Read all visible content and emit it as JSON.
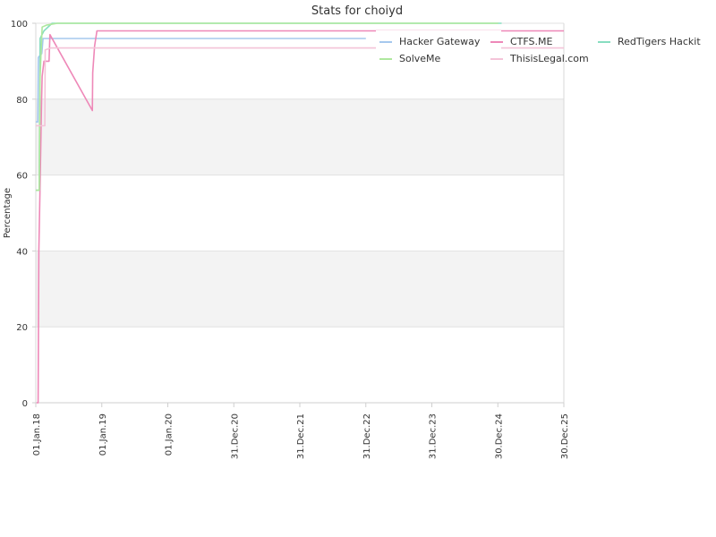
{
  "chart_data": {
    "type": "line",
    "title": "Stats for choiyd",
    "ylabel": "Percentage",
    "xlabel": "",
    "ylim": [
      0,
      100
    ],
    "yticks": [
      0,
      20,
      40,
      60,
      80,
      100
    ],
    "xlim": [
      "2018-01-01",
      "2025-12-30"
    ],
    "xticks": [
      {
        "date": "2018-01-01",
        "label": "01.Jan.18"
      },
      {
        "date": "2019-01-01",
        "label": "01.Jan.19"
      },
      {
        "date": "2020-01-01",
        "label": "01.Jan.20"
      },
      {
        "date": "2020-12-31",
        "label": "31.Dec.20"
      },
      {
        "date": "2021-12-31",
        "label": "31.Dec.21"
      },
      {
        "date": "2022-12-31",
        "label": "31.Dec.22"
      },
      {
        "date": "2023-12-31",
        "label": "31.Dec.23"
      },
      {
        "date": "2024-12-30",
        "label": "30.Dec.24"
      },
      {
        "date": "2025-12-30",
        "label": "30.Dec.25"
      }
    ],
    "grid": true,
    "legend_position": "top-right",
    "series": [
      {
        "name": "Hacker Gateway",
        "color": "#a6c8ee",
        "points": [
          [
            "2018-01-01",
            74
          ],
          [
            "2018-01-12",
            74
          ],
          [
            "2018-01-15",
            91
          ],
          [
            "2018-02-03",
            92
          ],
          [
            "2018-02-10",
            96
          ],
          [
            "2022-12-31",
            96
          ]
        ]
      },
      {
        "name": "CTFS.ME",
        "color": "#ee88b8",
        "points": [
          [
            "2018-01-05",
            0
          ],
          [
            "2018-01-14",
            0
          ],
          [
            "2018-01-18",
            40
          ],
          [
            "2018-01-24",
            55
          ],
          [
            "2018-02-02",
            80
          ],
          [
            "2018-02-05",
            86
          ],
          [
            "2018-02-15",
            90
          ],
          [
            "2018-03-15",
            90
          ],
          [
            "2018-03-20",
            97
          ],
          [
            "2018-11-10",
            77
          ],
          [
            "2018-11-12",
            87
          ],
          [
            "2018-11-22",
            94
          ],
          [
            "2018-12-05",
            98
          ],
          [
            "2025-12-30",
            98
          ]
        ]
      },
      {
        "name": "RedTigers Hackit",
        "color": "#88ddc0",
        "points": [
          [
            "2018-01-01",
            56
          ],
          [
            "2018-01-20",
            56
          ],
          [
            "2018-01-25",
            96
          ],
          [
            "2018-02-15",
            98
          ],
          [
            "2018-04-01",
            100
          ],
          [
            "2025-01-20",
            100
          ]
        ]
      },
      {
        "name": "SolveMe",
        "color": "#aee89e",
        "points": [
          [
            "2018-01-01",
            56
          ],
          [
            "2018-01-20",
            56
          ],
          [
            "2018-01-25",
            86
          ],
          [
            "2018-02-05",
            99
          ],
          [
            "2018-03-01",
            99.5
          ],
          [
            "2018-05-01",
            100
          ],
          [
            "2025-01-01",
            100
          ]
        ]
      },
      {
        "name": "ThisisLegal.com",
        "color": "#f4c4d8",
        "points": [
          [
            "2018-01-01",
            73
          ],
          [
            "2018-02-20",
            73
          ],
          [
            "2018-02-22",
            93
          ],
          [
            "2018-03-25",
            93.5
          ],
          [
            "2025-12-30",
            93.5
          ]
        ]
      }
    ]
  }
}
